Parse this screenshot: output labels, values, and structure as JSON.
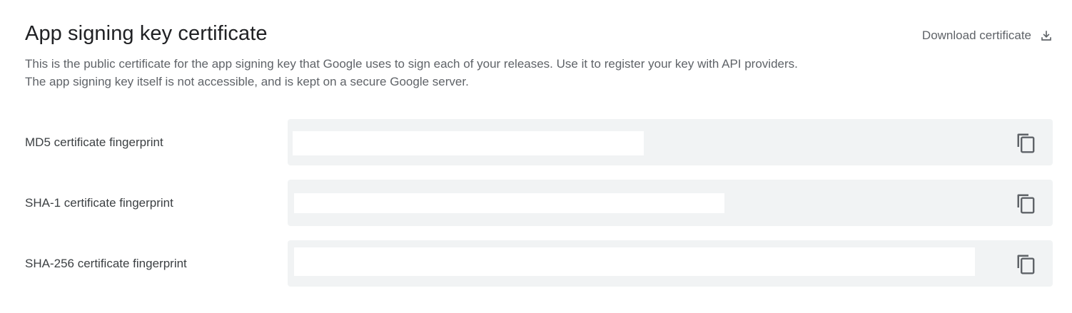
{
  "header": {
    "title": "App signing key certificate",
    "download_label": "Download certificate",
    "download_icon": "download-icon"
  },
  "description": "This is the public certificate for the app signing key that Google uses to sign each of your releases. Use it to register your key with API providers. The app signing key itself is not accessible, and is kept on a secure Google server.",
  "fingerprints": [
    {
      "label": "MD5 certificate fingerprint",
      "value": "",
      "copy_icon": "copy-icon"
    },
    {
      "label": "SHA-1 certificate fingerprint",
      "value": "",
      "copy_icon": "copy-icon"
    },
    {
      "label": "SHA-256 certificate fingerprint",
      "value": "",
      "copy_icon": "copy-icon"
    }
  ],
  "colors": {
    "field_background": "#f1f3f4",
    "value_background": "#ffffff",
    "icon": "#5f6368"
  }
}
